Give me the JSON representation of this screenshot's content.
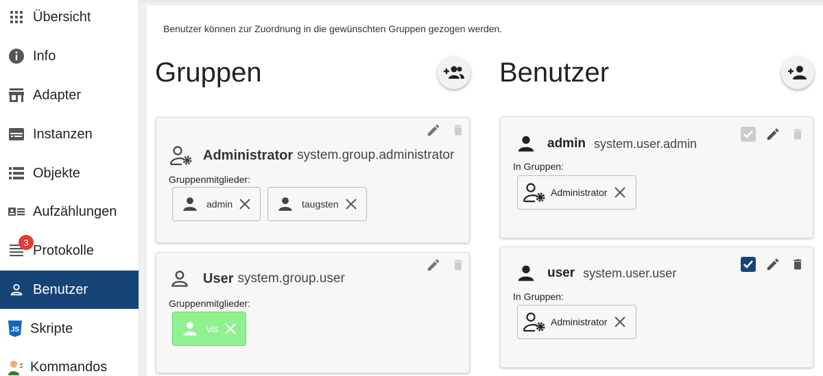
{
  "sidebar": {
    "items": [
      {
        "label": "Übersicht",
        "icon": "grid-icon"
      },
      {
        "label": "Info",
        "icon": "info-icon"
      },
      {
        "label": "Adapter",
        "icon": "store-icon"
      },
      {
        "label": "Instanzen",
        "icon": "instances-icon"
      },
      {
        "label": "Objekte",
        "icon": "list-icon"
      },
      {
        "label": "Aufzählungen",
        "icon": "enum-icon"
      },
      {
        "label": "Protokolle",
        "icon": "log-icon",
        "badge": "3"
      },
      {
        "label": "Benutzer",
        "icon": "user-icon",
        "active": true
      },
      {
        "label": "Skripte",
        "icon": "js-icon"
      },
      {
        "label": "Kommandos",
        "icon": "commands-icon"
      }
    ]
  },
  "main": {
    "hint": "Benutzer können zur Zuordnung in die gewünschten Gruppen gezogen werden.",
    "groups_title": "Gruppen",
    "users_title": "Benutzer",
    "groups": [
      {
        "name": "Administrator",
        "id": "system.group.administrator",
        "members_label": "Gruppenmitglieder:",
        "members": [
          "admin",
          "taugsten"
        ]
      },
      {
        "name": "User",
        "id": "system.group.user",
        "members_label": "Gruppenmitglieder:",
        "members": [
          "vis"
        ]
      }
    ],
    "users": [
      {
        "name": "admin",
        "id": "system.user.admin",
        "groups_label": "In Gruppen:",
        "groups": [
          "Administrator"
        ],
        "enabled": true,
        "disabled_toggle": true
      },
      {
        "name": "user",
        "id": "system.user.user",
        "groups_label": "In Gruppen:",
        "groups": [
          "Administrator"
        ],
        "enabled": true,
        "disabled_toggle": false
      }
    ]
  },
  "colors": {
    "sidebar_active": "#164477",
    "badge": "#e53935",
    "chip_highlight": "#8ff28f",
    "checkbox_active": "#164477"
  }
}
